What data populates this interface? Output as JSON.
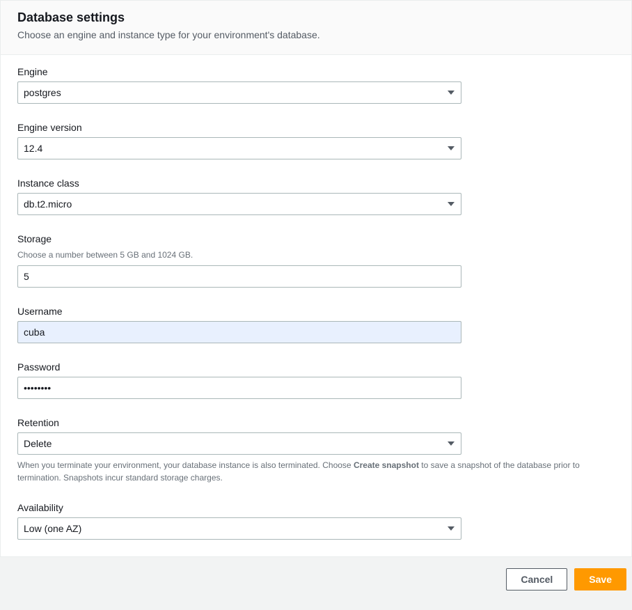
{
  "header": {
    "title": "Database settings",
    "subtitle": "Choose an engine and instance type for your environment's database."
  },
  "fields": {
    "engine": {
      "label": "Engine",
      "value": "postgres"
    },
    "engine_version": {
      "label": "Engine version",
      "value": "12.4"
    },
    "instance_class": {
      "label": "Instance class",
      "value": "db.t2.micro"
    },
    "storage": {
      "label": "Storage",
      "help": "Choose a number between 5 GB and 1024 GB.",
      "value": "5"
    },
    "username": {
      "label": "Username",
      "value": "cuba"
    },
    "password": {
      "label": "Password",
      "value": "••••••••"
    },
    "retention": {
      "label": "Retention",
      "value": "Delete",
      "help_prefix": "When you terminate your environment, your database instance is also terminated. Choose ",
      "help_bold": "Create snapshot",
      "help_suffix": " to save a snapshot of the database prior to termination. Snapshots incur standard storage charges."
    },
    "availability": {
      "label": "Availability",
      "value": "Low (one AZ)"
    }
  },
  "footer": {
    "cancel": "Cancel",
    "save": "Save"
  }
}
